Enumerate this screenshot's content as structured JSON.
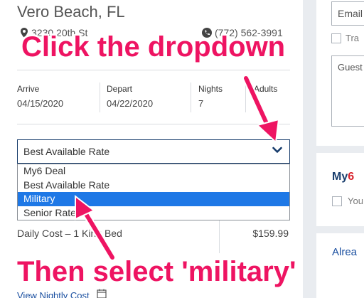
{
  "hotel": {
    "city": "Vero Beach, FL",
    "address": "3230 20th St",
    "phone": "(772) 562-3991"
  },
  "stay": {
    "arrive_label": "Arrive",
    "arrive_value": "04/15/2020",
    "depart_label": "Depart",
    "depart_value": "04/22/2020",
    "nights_label": "Nights",
    "nights_value": "7",
    "adults_label": "Adults"
  },
  "rate_select": {
    "selected": "Best Available Rate",
    "options": [
      "My6 Deal",
      "Best Available Rate",
      "Military",
      "Senior Rate"
    ],
    "highlighted_index": 2
  },
  "cost": {
    "label": "Daily Cost – 1 King Bed",
    "value": "$159.99"
  },
  "partial_link": "View Nightly Cost",
  "right_panel": {
    "email_placeholder": "Email",
    "travel_checkbox_label": "Tra",
    "guests_placeholder": "Guest",
    "my6_prefix": "My",
    "my6_number": "6",
    "you_text": "You",
    "already_text": "Alrea"
  },
  "annotations": {
    "top": "Click the dropdown",
    "bottom": "Then select 'military'"
  },
  "colors": {
    "annotation": "#ee1462",
    "highlight": "#1e78e6",
    "navy": "#163b6b"
  }
}
